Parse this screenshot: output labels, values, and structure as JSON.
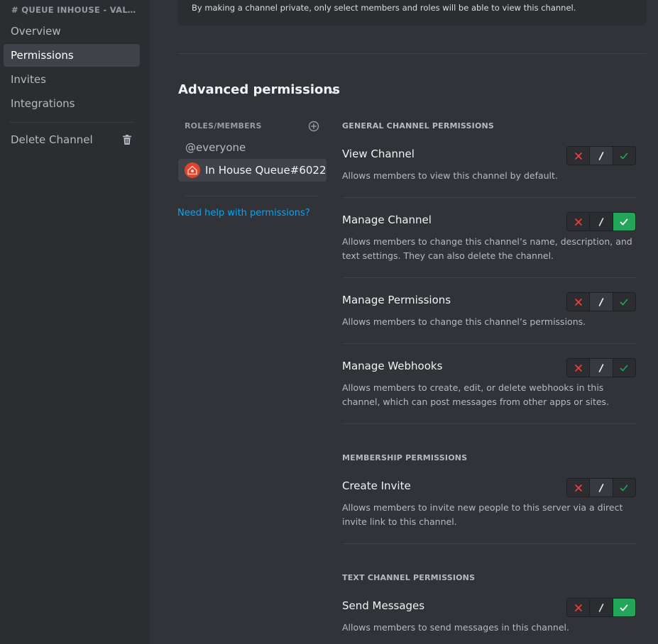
{
  "sidebar": {
    "channel_header": "# QUEUE INHOUSE - VALORANT",
    "items": [
      {
        "label": "Overview"
      },
      {
        "label": "Permissions"
      },
      {
        "label": "Invites"
      },
      {
        "label": "Integrations"
      }
    ],
    "delete_label": "Delete Channel",
    "delete_icon": "trash-icon"
  },
  "main": {
    "private_note": "By making a channel private, only select members and roles will be able to view this channel.",
    "advanced_title": "Advanced permissions",
    "roles": {
      "header": "ROLES/MEMBERS",
      "items": [
        {
          "label": "@everyone"
        },
        {
          "label": "In House Queue#6022"
        }
      ],
      "help_link": "Need help with permissions?"
    },
    "sections": [
      {
        "header": "GENERAL CHANNEL PERMISSIONS",
        "permissions": [
          {
            "name": "View Channel",
            "description": "Allows members to view this channel by default.",
            "state": "passthrough"
          },
          {
            "name": "Manage Channel",
            "description": "Allows members to change this channel’s name, description, and text settings. They can also delete the channel.",
            "state": "allow"
          },
          {
            "name": "Manage Permissions",
            "description": "Allows members to change this channel’s permissions.",
            "state": "passthrough"
          },
          {
            "name": "Manage Webhooks",
            "description": "Allows members to create, edit, or delete webhooks in this channel, which can post messages from other apps or sites.",
            "state": "passthrough"
          }
        ]
      },
      {
        "header": "MEMBERSHIP PERMISSIONS",
        "permissions": [
          {
            "name": "Create Invite",
            "description": "Allows members to invite new people to this server via a direct invite link to this channel.",
            "state": "passthrough"
          }
        ]
      },
      {
        "header": "TEXT CHANNEL PERMISSIONS",
        "permissions": [
          {
            "name": "Send Messages",
            "description": "Allows members to send messages in this channel.",
            "state": "allow"
          }
        ]
      }
    ]
  },
  "colors": {
    "deny": "#f23f43",
    "allow": "#23a55a",
    "link": "#00a8fc",
    "active_item": "#404249"
  }
}
